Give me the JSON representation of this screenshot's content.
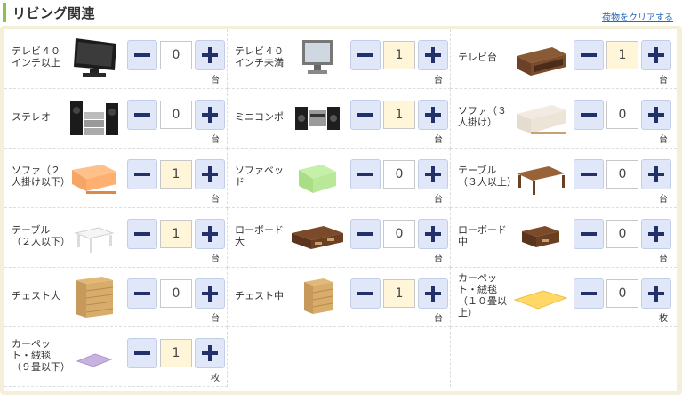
{
  "section": {
    "title": "リビング関連",
    "clear_link": "荷物をクリアする"
  },
  "items": [
    {
      "name": "テレビ４０インチ以上",
      "icon": "large-tv-icon",
      "qty": "0",
      "unit": "台"
    },
    {
      "name": "テレビ４０インチ未満",
      "icon": "small-tv-icon",
      "qty": "1",
      "unit": "台"
    },
    {
      "name": "テレビ台",
      "icon": "tv-stand-icon",
      "qty": "1",
      "unit": "台"
    },
    {
      "name": "ステレオ",
      "icon": "stereo-icon",
      "qty": "0",
      "unit": "台"
    },
    {
      "name": "ミニコンポ",
      "icon": "mini-stereo-icon",
      "qty": "1",
      "unit": "台"
    },
    {
      "name": "ソファ（３人掛け）",
      "icon": "three-seat-sofa-icon",
      "qty": "0",
      "unit": "台"
    },
    {
      "name": "ソファ（２人掛け以下）",
      "icon": "two-seat-sofa-icon",
      "qty": "1",
      "unit": "台"
    },
    {
      "name": "ソファベッド",
      "icon": "sofa-bed-icon",
      "qty": "0",
      "unit": "台"
    },
    {
      "name": "テーブル（３人以上）",
      "icon": "large-table-icon",
      "qty": "0",
      "unit": "台"
    },
    {
      "name": "テーブル（２人以下）",
      "icon": "small-table-icon",
      "qty": "1",
      "unit": "台"
    },
    {
      "name": "ローボード大",
      "icon": "large-lowboard-icon",
      "qty": "0",
      "unit": "台"
    },
    {
      "name": "ローボード中",
      "icon": "medium-lowboard-icon",
      "qty": "0",
      "unit": "台"
    },
    {
      "name": "チェスト大",
      "icon": "large-chest-icon",
      "qty": "0",
      "unit": "台"
    },
    {
      "name": "チェスト中",
      "icon": "medium-chest-icon",
      "qty": "1",
      "unit": "台"
    },
    {
      "name": "カーペット・絨毯（１０畳以上）",
      "icon": "large-carpet-icon",
      "qty": "0",
      "unit": "枚"
    },
    {
      "name": "カーペット・絨毯（９畳以下）",
      "icon": "small-carpet-icon",
      "qty": "1",
      "unit": "枚"
    }
  ]
}
